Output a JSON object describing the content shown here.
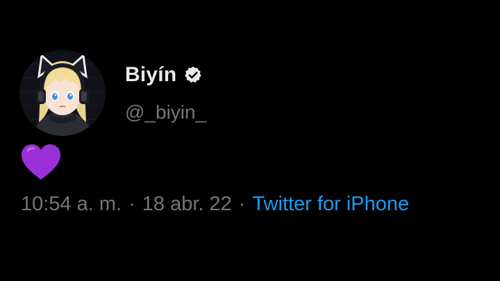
{
  "tweet": {
    "author": {
      "display_name": "Biyín",
      "handle": "@_biyin_",
      "verified": true,
      "verified_icon": "verified-badge-icon",
      "avatar": "cat-ear-headphones-anime-avatar"
    },
    "content": {
      "emoji": "💜",
      "emoji_icon": "purple-heart-icon"
    },
    "meta": {
      "time": "10:54 a. m.",
      "separator": "·",
      "date": "18 abr. 22",
      "source": "Twitter for iPhone"
    }
  },
  "colors": {
    "background": "#000000",
    "primary_text": "#e7e9ea",
    "secondary_text": "#71767b",
    "link": "#1d9bf0",
    "heart": "#9b30d9"
  }
}
